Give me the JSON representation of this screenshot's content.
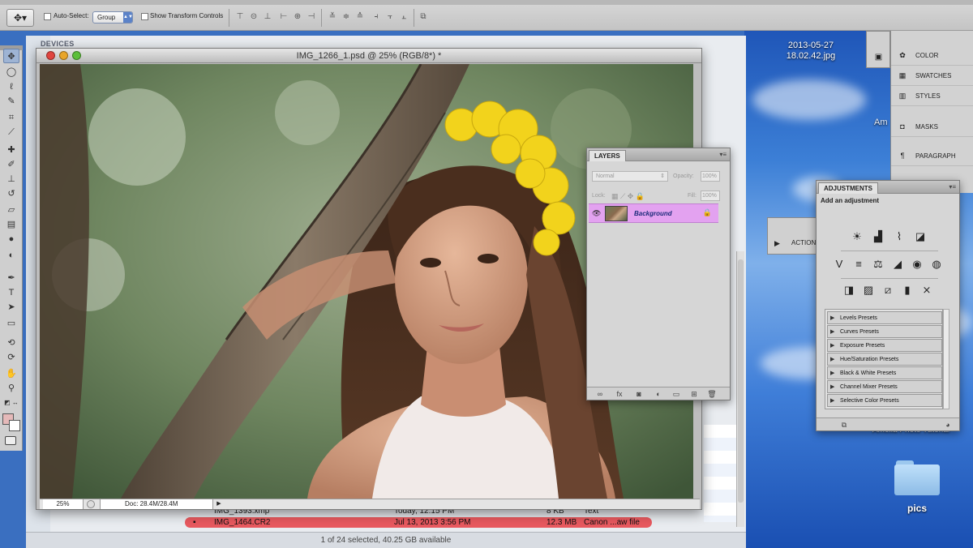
{
  "options_bar": {
    "tool_preset_icon": "move-tool-icon",
    "auto_select_label": "Auto-Select:",
    "auto_select_value": "Group",
    "show_transform_label": "Show Transform Controls"
  },
  "toolbox": {
    "tools": [
      "move-tool",
      "marquee-tool",
      "lasso-tool",
      "quick-selection-tool",
      "crop-tool",
      "eyedropper-tool",
      "healing-brush-tool",
      "brush-tool",
      "clone-stamp-tool",
      "history-brush-tool",
      "eraser-tool",
      "gradient-tool",
      "blur-tool",
      "dodge-tool",
      "pen-tool",
      "type-tool",
      "path-selection-tool",
      "rectangle-tool",
      "3d-rotate-tool",
      "3d-orbit-tool",
      "hand-tool",
      "zoom-tool"
    ],
    "foreground_color": "#e5b9b9",
    "background_color": "#ffffff"
  },
  "finder": {
    "sidebar_heading": "DEVICES",
    "files": [
      {
        "name": "IMG_1393.xmp",
        "date": "Today, 12:15 PM",
        "size": "8 KB",
        "kind": "Text"
      },
      {
        "name": "IMG_1464.CR2",
        "date": "Jul 13, 2013 3:56 PM",
        "size": "12.3 MB",
        "kind": "Canon ...aw file"
      }
    ],
    "status": "1 of 24 selected, 40.25 GB available"
  },
  "document": {
    "title": "IMG_1266_1.psd @ 25% (RGB/8*) *",
    "zoom": "25%",
    "doc_info": "Doc: 28.4M/28.4M"
  },
  "layers_panel": {
    "tab": "LAYERS",
    "blend_mode": "Normal",
    "opacity_label": "Opacity:",
    "opacity_value": "100%",
    "lock_label": "Lock:",
    "fill_label": "Fill:",
    "fill_value": "100%",
    "layer_name": "Background"
  },
  "adjustments_panel": {
    "tab": "ADJUSTMENTS",
    "heading": "Add an adjustment",
    "presets": [
      "Levels Presets",
      "Curves Presets",
      "Exposure Presets",
      "Hue/Saturation Presets",
      "Black & White Presets",
      "Channel Mixer Presets",
      "Selective Color Presets"
    ]
  },
  "dock": {
    "items": [
      "COLOR",
      "SWATCHES",
      "STYLES",
      "MASKS",
      "PARAGRAPH"
    ],
    "actions_label": "ACTION"
  },
  "desktop": {
    "file_label_line1": "2013-05-27",
    "file_label_line2": "18.02.42.jpg",
    "folder_label": "pics",
    "partial_text_1": "Am",
    "partial_text_2": "Amelia Photo Tutorial"
  }
}
